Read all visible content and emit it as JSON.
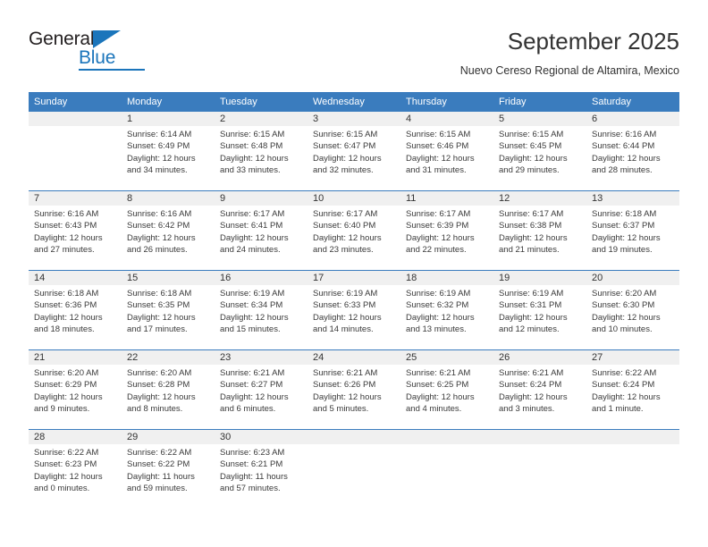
{
  "brand": {
    "name_top": "General",
    "name_bottom": "Blue",
    "accent_color": "#1b75bb"
  },
  "header": {
    "title": "September 2025",
    "subtitle": "Nuevo Cereso Regional de Altamira, Mexico"
  },
  "theme": {
    "header_blue": "#3a7cbe",
    "daynum_band": "#f0f0f0",
    "text": "#3a3a3a"
  },
  "weekday_headers": [
    "Sunday",
    "Monday",
    "Tuesday",
    "Wednesday",
    "Thursday",
    "Friday",
    "Saturday"
  ],
  "weeks": [
    [
      {
        "day": "",
        "sunrise": "",
        "sunset": "",
        "daylight_line1": "",
        "daylight_line2": ""
      },
      {
        "day": "1",
        "sunrise": "Sunrise: 6:14 AM",
        "sunset": "Sunset: 6:49 PM",
        "daylight_line1": "Daylight: 12 hours",
        "daylight_line2": "and 34 minutes."
      },
      {
        "day": "2",
        "sunrise": "Sunrise: 6:15 AM",
        "sunset": "Sunset: 6:48 PM",
        "daylight_line1": "Daylight: 12 hours",
        "daylight_line2": "and 33 minutes."
      },
      {
        "day": "3",
        "sunrise": "Sunrise: 6:15 AM",
        "sunset": "Sunset: 6:47 PM",
        "daylight_line1": "Daylight: 12 hours",
        "daylight_line2": "and 32 minutes."
      },
      {
        "day": "4",
        "sunrise": "Sunrise: 6:15 AM",
        "sunset": "Sunset: 6:46 PM",
        "daylight_line1": "Daylight: 12 hours",
        "daylight_line2": "and 31 minutes."
      },
      {
        "day": "5",
        "sunrise": "Sunrise: 6:15 AM",
        "sunset": "Sunset: 6:45 PM",
        "daylight_line1": "Daylight: 12 hours",
        "daylight_line2": "and 29 minutes."
      },
      {
        "day": "6",
        "sunrise": "Sunrise: 6:16 AM",
        "sunset": "Sunset: 6:44 PM",
        "daylight_line1": "Daylight: 12 hours",
        "daylight_line2": "and 28 minutes."
      }
    ],
    [
      {
        "day": "7",
        "sunrise": "Sunrise: 6:16 AM",
        "sunset": "Sunset: 6:43 PM",
        "daylight_line1": "Daylight: 12 hours",
        "daylight_line2": "and 27 minutes."
      },
      {
        "day": "8",
        "sunrise": "Sunrise: 6:16 AM",
        "sunset": "Sunset: 6:42 PM",
        "daylight_line1": "Daylight: 12 hours",
        "daylight_line2": "and 26 minutes."
      },
      {
        "day": "9",
        "sunrise": "Sunrise: 6:17 AM",
        "sunset": "Sunset: 6:41 PM",
        "daylight_line1": "Daylight: 12 hours",
        "daylight_line2": "and 24 minutes."
      },
      {
        "day": "10",
        "sunrise": "Sunrise: 6:17 AM",
        "sunset": "Sunset: 6:40 PM",
        "daylight_line1": "Daylight: 12 hours",
        "daylight_line2": "and 23 minutes."
      },
      {
        "day": "11",
        "sunrise": "Sunrise: 6:17 AM",
        "sunset": "Sunset: 6:39 PM",
        "daylight_line1": "Daylight: 12 hours",
        "daylight_line2": "and 22 minutes."
      },
      {
        "day": "12",
        "sunrise": "Sunrise: 6:17 AM",
        "sunset": "Sunset: 6:38 PM",
        "daylight_line1": "Daylight: 12 hours",
        "daylight_line2": "and 21 minutes."
      },
      {
        "day": "13",
        "sunrise": "Sunrise: 6:18 AM",
        "sunset": "Sunset: 6:37 PM",
        "daylight_line1": "Daylight: 12 hours",
        "daylight_line2": "and 19 minutes."
      }
    ],
    [
      {
        "day": "14",
        "sunrise": "Sunrise: 6:18 AM",
        "sunset": "Sunset: 6:36 PM",
        "daylight_line1": "Daylight: 12 hours",
        "daylight_line2": "and 18 minutes."
      },
      {
        "day": "15",
        "sunrise": "Sunrise: 6:18 AM",
        "sunset": "Sunset: 6:35 PM",
        "daylight_line1": "Daylight: 12 hours",
        "daylight_line2": "and 17 minutes."
      },
      {
        "day": "16",
        "sunrise": "Sunrise: 6:19 AM",
        "sunset": "Sunset: 6:34 PM",
        "daylight_line1": "Daylight: 12 hours",
        "daylight_line2": "and 15 minutes."
      },
      {
        "day": "17",
        "sunrise": "Sunrise: 6:19 AM",
        "sunset": "Sunset: 6:33 PM",
        "daylight_line1": "Daylight: 12 hours",
        "daylight_line2": "and 14 minutes."
      },
      {
        "day": "18",
        "sunrise": "Sunrise: 6:19 AM",
        "sunset": "Sunset: 6:32 PM",
        "daylight_line1": "Daylight: 12 hours",
        "daylight_line2": "and 13 minutes."
      },
      {
        "day": "19",
        "sunrise": "Sunrise: 6:19 AM",
        "sunset": "Sunset: 6:31 PM",
        "daylight_line1": "Daylight: 12 hours",
        "daylight_line2": "and 12 minutes."
      },
      {
        "day": "20",
        "sunrise": "Sunrise: 6:20 AM",
        "sunset": "Sunset: 6:30 PM",
        "daylight_line1": "Daylight: 12 hours",
        "daylight_line2": "and 10 minutes."
      }
    ],
    [
      {
        "day": "21",
        "sunrise": "Sunrise: 6:20 AM",
        "sunset": "Sunset: 6:29 PM",
        "daylight_line1": "Daylight: 12 hours",
        "daylight_line2": "and 9 minutes."
      },
      {
        "day": "22",
        "sunrise": "Sunrise: 6:20 AM",
        "sunset": "Sunset: 6:28 PM",
        "daylight_line1": "Daylight: 12 hours",
        "daylight_line2": "and 8 minutes."
      },
      {
        "day": "23",
        "sunrise": "Sunrise: 6:21 AM",
        "sunset": "Sunset: 6:27 PM",
        "daylight_line1": "Daylight: 12 hours",
        "daylight_line2": "and 6 minutes."
      },
      {
        "day": "24",
        "sunrise": "Sunrise: 6:21 AM",
        "sunset": "Sunset: 6:26 PM",
        "daylight_line1": "Daylight: 12 hours",
        "daylight_line2": "and 5 minutes."
      },
      {
        "day": "25",
        "sunrise": "Sunrise: 6:21 AM",
        "sunset": "Sunset: 6:25 PM",
        "daylight_line1": "Daylight: 12 hours",
        "daylight_line2": "and 4 minutes."
      },
      {
        "day": "26",
        "sunrise": "Sunrise: 6:21 AM",
        "sunset": "Sunset: 6:24 PM",
        "daylight_line1": "Daylight: 12 hours",
        "daylight_line2": "and 3 minutes."
      },
      {
        "day": "27",
        "sunrise": "Sunrise: 6:22 AM",
        "sunset": "Sunset: 6:24 PM",
        "daylight_line1": "Daylight: 12 hours",
        "daylight_line2": "and 1 minute."
      }
    ],
    [
      {
        "day": "28",
        "sunrise": "Sunrise: 6:22 AM",
        "sunset": "Sunset: 6:23 PM",
        "daylight_line1": "Daylight: 12 hours",
        "daylight_line2": "and 0 minutes."
      },
      {
        "day": "29",
        "sunrise": "Sunrise: 6:22 AM",
        "sunset": "Sunset: 6:22 PM",
        "daylight_line1": "Daylight: 11 hours",
        "daylight_line2": "and 59 minutes."
      },
      {
        "day": "30",
        "sunrise": "Sunrise: 6:23 AM",
        "sunset": "Sunset: 6:21 PM",
        "daylight_line1": "Daylight: 11 hours",
        "daylight_line2": "and 57 minutes."
      },
      {
        "day": "",
        "sunrise": "",
        "sunset": "",
        "daylight_line1": "",
        "daylight_line2": ""
      },
      {
        "day": "",
        "sunrise": "",
        "sunset": "",
        "daylight_line1": "",
        "daylight_line2": ""
      },
      {
        "day": "",
        "sunrise": "",
        "sunset": "",
        "daylight_line1": "",
        "daylight_line2": ""
      },
      {
        "day": "",
        "sunrise": "",
        "sunset": "",
        "daylight_line1": "",
        "daylight_line2": ""
      }
    ]
  ]
}
